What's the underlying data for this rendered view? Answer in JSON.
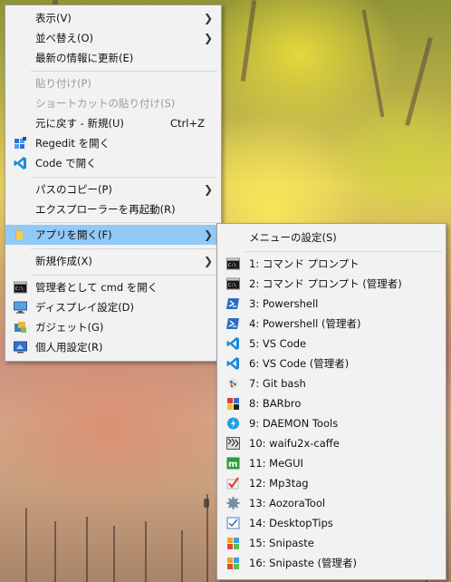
{
  "main_menu": {
    "items": [
      {
        "label": "表示(V)",
        "accel": "",
        "submenu": true,
        "disabled": false,
        "icon": ""
      },
      {
        "label": "並べ替え(O)",
        "accel": "",
        "submenu": true,
        "disabled": false,
        "icon": ""
      },
      {
        "label": "最新の情報に更新(E)",
        "accel": "",
        "submenu": false,
        "disabled": false,
        "icon": ""
      },
      {
        "label": "貼り付け(P)",
        "accel": "",
        "submenu": false,
        "disabled": true,
        "icon": ""
      },
      {
        "label": "ショートカットの貼り付け(S)",
        "accel": "",
        "submenu": false,
        "disabled": true,
        "icon": ""
      },
      {
        "label": "元に戻す - 新規(U)",
        "accel": "Ctrl+Z",
        "submenu": false,
        "disabled": false,
        "icon": ""
      },
      {
        "label": "Regedit を開く",
        "accel": "",
        "submenu": false,
        "disabled": false,
        "icon": "regedit-icon"
      },
      {
        "label": "Code で開く",
        "accel": "",
        "submenu": false,
        "disabled": false,
        "icon": "vscode-icon"
      },
      {
        "label": "パスのコピー(P)",
        "accel": "",
        "submenu": true,
        "disabled": false,
        "icon": ""
      },
      {
        "label": "エクスプローラーを再起動(R)",
        "accel": "",
        "submenu": false,
        "disabled": false,
        "icon": ""
      },
      {
        "label": "アプリを開く(F)",
        "accel": "",
        "submenu": true,
        "disabled": false,
        "icon": "folder-icon",
        "highlight": true
      },
      {
        "label": "新規作成(X)",
        "accel": "",
        "submenu": true,
        "disabled": false,
        "icon": ""
      },
      {
        "label": "管理者として cmd を開く",
        "accel": "",
        "submenu": false,
        "disabled": false,
        "icon": "cmd-icon"
      },
      {
        "label": "ディスプレイ設定(D)",
        "accel": "",
        "submenu": false,
        "disabled": false,
        "icon": "display-icon"
      },
      {
        "label": "ガジェット(G)",
        "accel": "",
        "submenu": false,
        "disabled": false,
        "icon": "gadget-icon"
      },
      {
        "label": "個人用設定(R)",
        "accel": "",
        "submenu": false,
        "disabled": false,
        "icon": "personalize-icon"
      }
    ]
  },
  "sub_menu": {
    "header": "メニューの設定(S)",
    "items": [
      {
        "label": "1: コマンド プロンプト",
        "icon": "cmd-icon"
      },
      {
        "label": "2: コマンド プロンプト (管理者)",
        "icon": "cmd-icon"
      },
      {
        "label": "3: Powershell",
        "icon": "powershell-icon"
      },
      {
        "label": "4: Powershell (管理者)",
        "icon": "powershell-icon"
      },
      {
        "label": "5: VS Code",
        "icon": "vscode-icon"
      },
      {
        "label": "6: VS Code (管理者)",
        "icon": "vscode-icon"
      },
      {
        "label": "7: Git bash",
        "icon": "git-icon"
      },
      {
        "label": "8: BARbro",
        "icon": "barbro-icon"
      },
      {
        "label": "9: DAEMON Tools",
        "icon": "daemon-tools-icon"
      },
      {
        "label": "10: waifu2x-caffe",
        "icon": "waifu2x-icon"
      },
      {
        "label": "11: MeGUI",
        "icon": "megui-icon"
      },
      {
        "label": "12: Mp3tag",
        "icon": "mp3tag-icon"
      },
      {
        "label": "13: AozoraTool",
        "icon": "gear-icon"
      },
      {
        "label": "14: DesktopTips",
        "icon": "checklist-icon"
      },
      {
        "label": "15: Snipaste",
        "icon": "snipaste-icon"
      },
      {
        "label": "16: Snipaste (管理者)",
        "icon": "snipaste-icon"
      }
    ]
  },
  "colors": {
    "menu_bg": "#f2f2f2",
    "highlight": "#91c9f7",
    "disabled_text": "#9a9a9a"
  }
}
